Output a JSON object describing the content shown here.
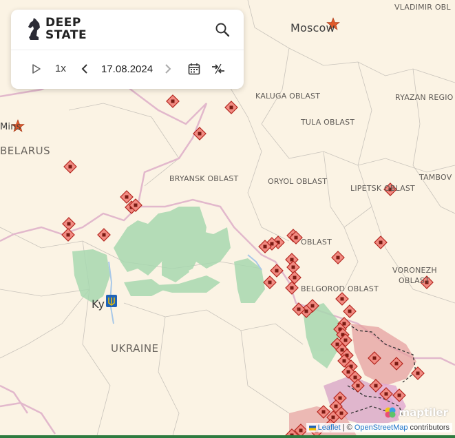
{
  "app": {
    "logo_line1": "DEEP",
    "logo_line2": "STATE"
  },
  "controls": {
    "speed": "1x",
    "date": "17.08.2024"
  },
  "labels": {
    "moscow": "Moscow",
    "vladimir": "VLADIMIR OBL",
    "kaluga": "KALUGA OBLAST",
    "ryazan": "RYAZAN REGIO",
    "tula": "TULA OBLAST",
    "minsk": "Mins",
    "belarus": "BELARUS",
    "bryansk": "BRYANSK OBLAST",
    "oryol": "ORYOL OBLAST",
    "lipetsk": "LIPETSK OBLAST",
    "tambov": "TAMBOV",
    "kursk": "OBLAST",
    "voronezh1": "VORONEZH",
    "voronezh2": "OBLAST",
    "belgorod": "BELGOROD OBLAST",
    "kyiv": "Ky",
    "ukraine": "UKRAINE"
  },
  "attribution": {
    "leaflet": "Leaflet",
    "sep": " | © ",
    "osm": "OpenStreetMap",
    "contrib": " contributors",
    "maptiler": "maptiler"
  },
  "colors": {
    "background": "#fbf3e4",
    "marker_fill": "#f28b82",
    "marker_stroke": "#b3261e",
    "liberated_green": "#9fd3a8",
    "occupied": "#d98c8c",
    "border": "#e2b8cc"
  }
}
